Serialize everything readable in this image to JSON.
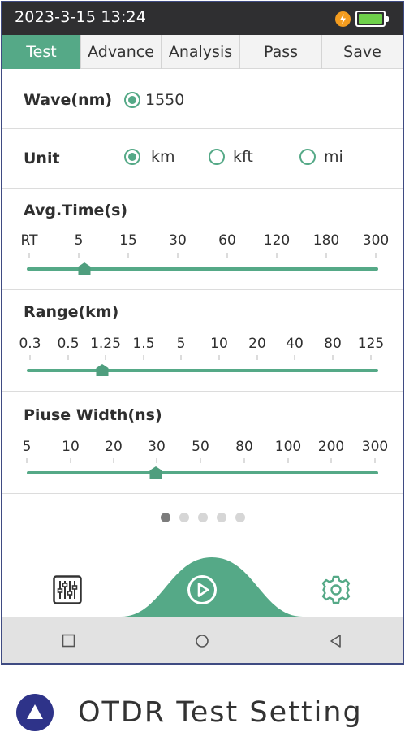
{
  "status": {
    "time": "2023-3-15 13:24",
    "battery_level": 1.0,
    "charging_icon": "lightning-icon"
  },
  "tabs": [
    {
      "label": "Test",
      "active": true
    },
    {
      "label": "Advance",
      "active": false
    },
    {
      "label": "Analysis",
      "active": false
    },
    {
      "label": "Pass",
      "active": false
    },
    {
      "label": "Save",
      "active": false
    }
  ],
  "wave": {
    "label": "Wave(nm)",
    "options": [
      {
        "label": "1550",
        "selected": true
      }
    ]
  },
  "unit": {
    "label": "Unit",
    "options": [
      {
        "label": "km",
        "selected": true
      },
      {
        "label": "kft",
        "selected": false
      },
      {
        "label": "mi",
        "selected": false
      }
    ]
  },
  "avg_time": {
    "label": "Avg.Time(s)",
    "ticks": [
      "RT",
      "5",
      "15",
      "30",
      "60",
      "120",
      "180",
      "300"
    ],
    "selected": "5"
  },
  "range": {
    "label": "Range(km)",
    "ticks": [
      "0.3",
      "0.5",
      "1.25",
      "1.5",
      "5",
      "10",
      "20",
      "40",
      "80",
      "125"
    ],
    "selected": "1.25"
  },
  "pulse": {
    "label": "Piuse Width(ns)",
    "ticks": [
      "5",
      "10",
      "20",
      "30",
      "50",
      "80",
      "100",
      "200",
      "300"
    ],
    "selected": "30"
  },
  "pager": {
    "pages": 5,
    "current": 1
  },
  "bottom": {
    "left_icon": "sliders-icon",
    "center_icon": "play-icon",
    "right_icon": "gear-icon"
  },
  "navbar": {
    "icons": [
      "square-icon",
      "circle-icon",
      "back-triangle-icon"
    ]
  },
  "caption": {
    "icon": "triangle-icon",
    "text": "OTDR Test Setting"
  },
  "colors": {
    "accent": "#55a987",
    "statusbar": "#2f2f31",
    "caption_icon": "#2e3389"
  }
}
